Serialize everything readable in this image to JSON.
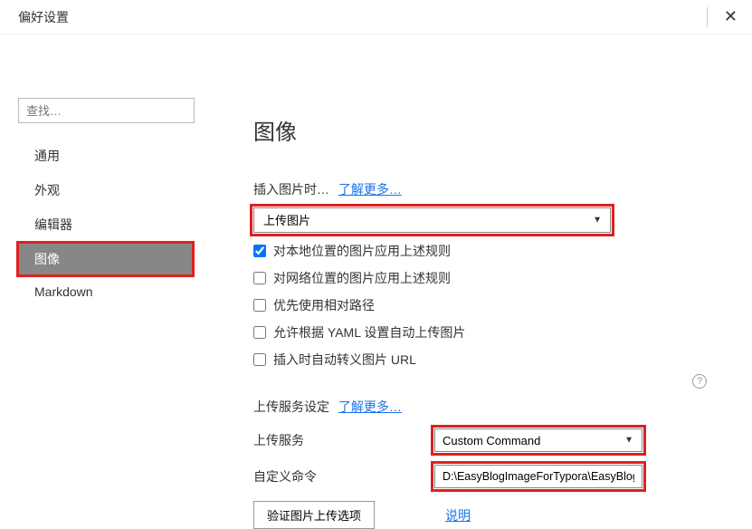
{
  "titlebar": {
    "title": "偏好设置"
  },
  "sidebar": {
    "search_placeholder": "查找…",
    "items": [
      {
        "label": "通用"
      },
      {
        "label": "外观"
      },
      {
        "label": "编辑器"
      },
      {
        "label": "图像"
      },
      {
        "label": "Markdown"
      }
    ]
  },
  "main": {
    "title": "图像",
    "insert_section": {
      "label": "插入图片时…",
      "learn_more": "了解更多…",
      "action_selected": "上传图片",
      "checkboxes": [
        {
          "label": "对本地位置的图片应用上述规则",
          "checked": true
        },
        {
          "label": "对网络位置的图片应用上述规则",
          "checked": false
        },
        {
          "label": "优先使用相对路径",
          "checked": false
        },
        {
          "label": "允许根据 YAML 设置自动上传图片",
          "checked": false
        },
        {
          "label": "插入时自动转义图片 URL",
          "checked": false
        }
      ]
    },
    "upload_section": {
      "label": "上传服务设定",
      "learn_more": "了解更多…",
      "service_label": "上传服务",
      "service_selected": "Custom Command",
      "command_label": "自定义命令",
      "command_value": "D:\\EasyBlogImageForTypora\\EasyBlogImageI",
      "test_button": "验证图片上传选项",
      "help_link": "说明"
    }
  }
}
